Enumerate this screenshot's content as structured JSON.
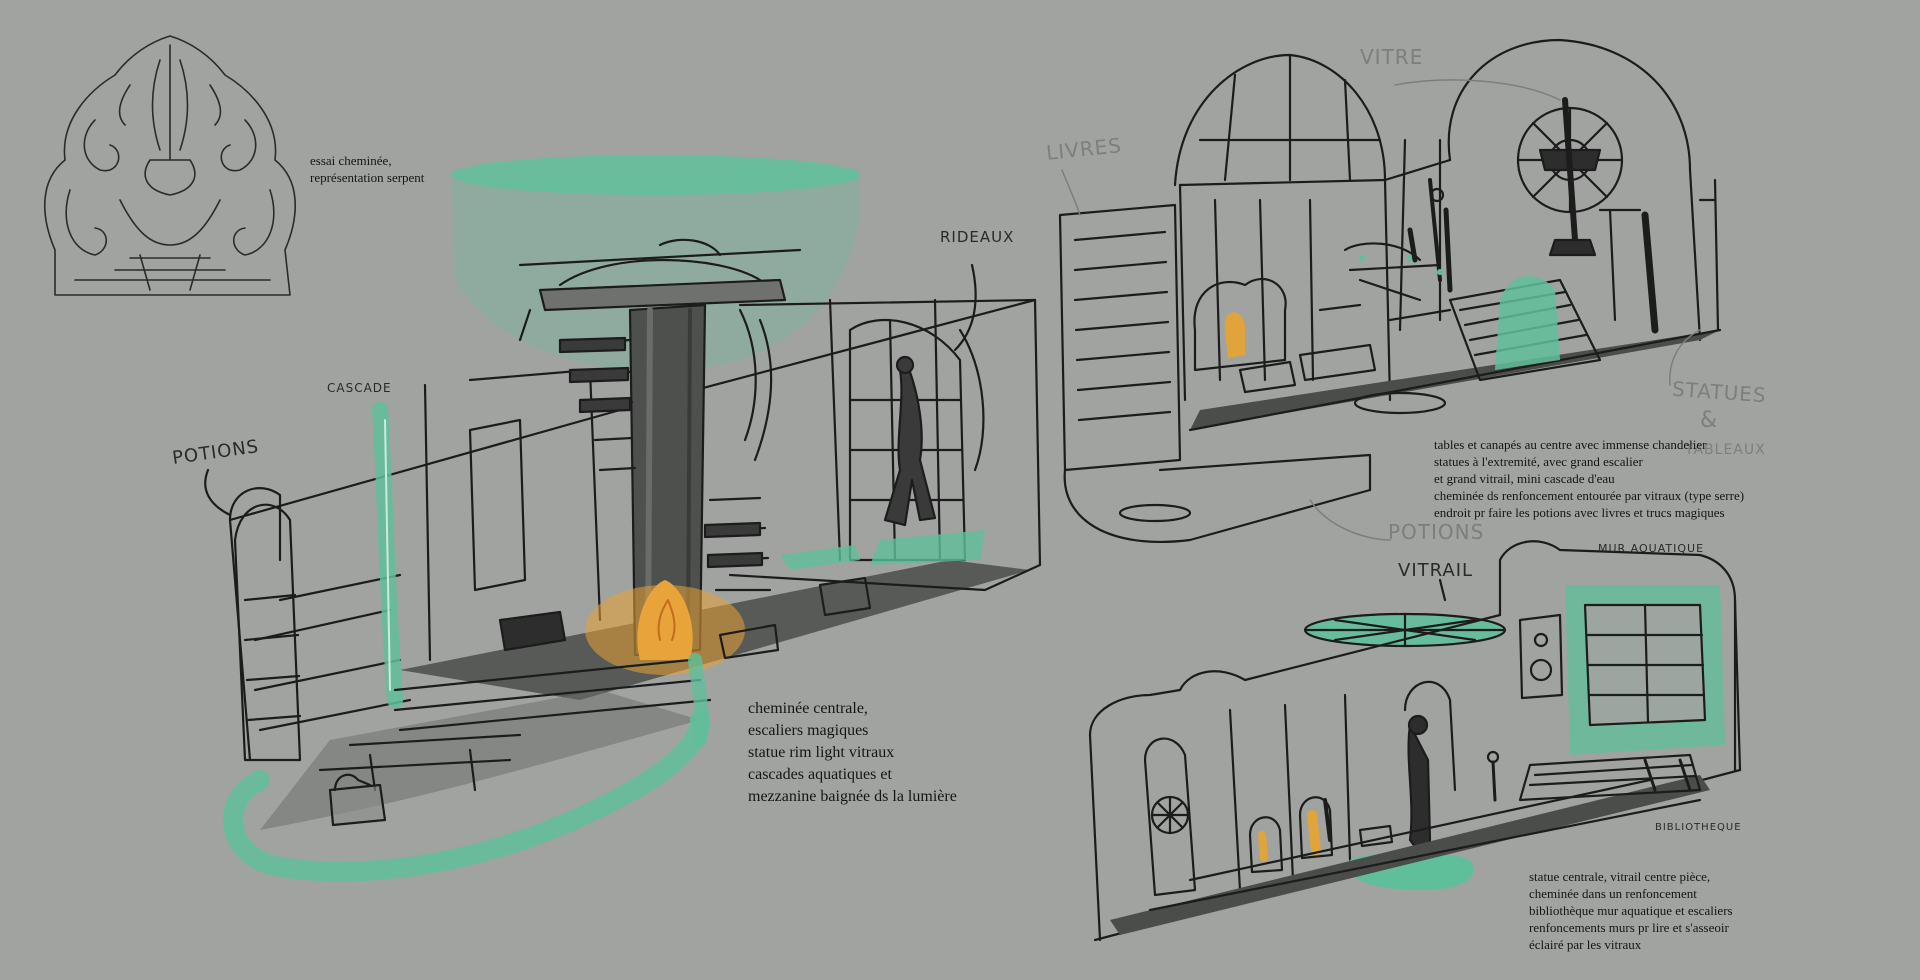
{
  "labels": {
    "cascade": "CASCADE",
    "potions_left": "POTIONS",
    "rideaux": "RIDEAUX",
    "livres": "LIVRES",
    "vitre": "VITRE",
    "statues": "STATUES",
    "et": "&",
    "tableaux": "TABLEAUX",
    "potions_right": "POTIONS",
    "vitrail": "VITRAIL",
    "mur_aquatique": "MUR AQUATIQUE",
    "bibliotheque": "BIBLIOTHEQUE"
  },
  "notes": {
    "fireplace": "essai cheminée,\nreprésentation serpent",
    "central": "cheminée centrale,\nescaliers magiques\nstatue rim light vitraux\ncascades aquatiques et\nmezzanine baignée ds la lumière",
    "upper_right": "tables et canapés au centre avec immense chandelier\nstatues à l'extremité, avec grand escalier\net grand vitrail, mini cascade d'eau\ncheminée ds renfoncement entourée par vitraux (type serre)\nendroit pr faire les potions avec livres et trucs magiques",
    "lower_right": "statue centrale, vitrail centre pièce,\ncheminée dans un renfoncement\nbibliothèque mur aquatique et escaliers\nrenfoncements murs pr lire et s'asseoir\néclairé par les vitraux"
  },
  "colors": {
    "background": "#a1a3a1",
    "line": "#1c1c1c",
    "aqua": "#5fbf9a",
    "fire": "#e0a43a",
    "floor": "#5a5c5a"
  }
}
